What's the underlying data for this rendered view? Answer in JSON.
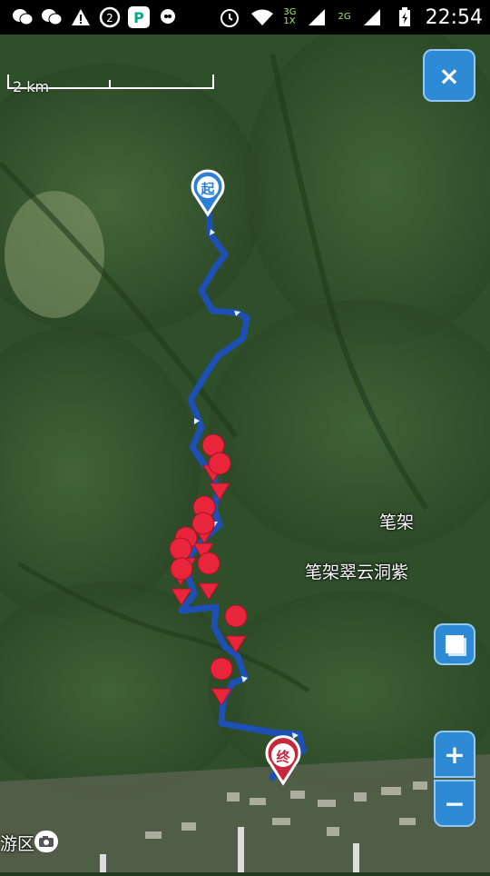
{
  "statusbar": {
    "icons_left": [
      "wechat-icon",
      "wechat-icon",
      "warning-icon",
      "sync-icon",
      "p-app-icon",
      "bubble-icon"
    ],
    "icons_right": [
      "alarm-icon",
      "wifi-icon",
      "signal-3g-icon",
      "signal-2g-icon",
      "battery-icon"
    ],
    "net_3g": "3G",
    "net_1x": "1X",
    "net_2g": "2G",
    "time": "22:54"
  },
  "map": {
    "scale_label": "2 km",
    "labels": {
      "bijia": "笔架",
      "cave": "笔架翠云洞紫",
      "district": "游区"
    },
    "start_marker": "起",
    "end_marker": "终",
    "route_color": "#1d4fb5",
    "waypoint_color": "#e8253a",
    "terrain_color": "#2e4f2a"
  },
  "controls": {
    "close": "×",
    "zoom_in": "+",
    "zoom_out": "−"
  }
}
